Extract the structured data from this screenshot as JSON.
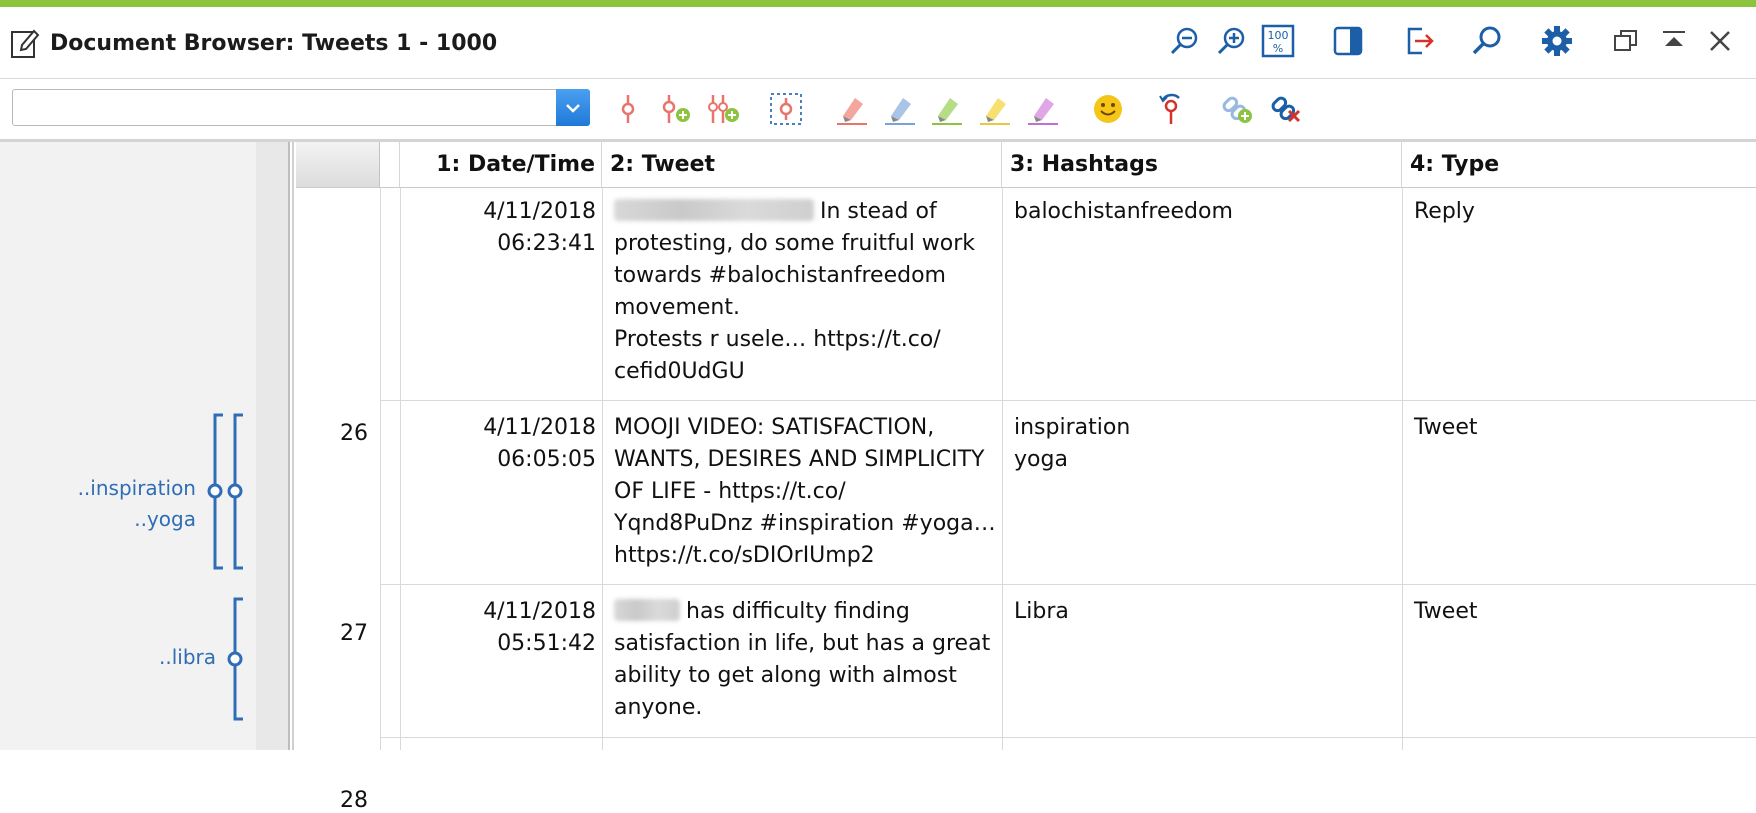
{
  "window": {
    "title": "Document Browser: Tweets 1 - 1000",
    "accent_color": "#8cc43f",
    "title_icons": [
      "zoom-out-icon",
      "zoom-in-icon",
      "zoom-100-icon",
      "panel-toggle-icon",
      "export-icon",
      "search-icon",
      "gear-icon",
      "restore-window-icon",
      "minimize-icon",
      "close-icon"
    ]
  },
  "toolbar": {
    "combo_value": "",
    "icons": [
      "code-icon",
      "code-add-icon",
      "code-multi-icon",
      "code-select-icon",
      "highlight-red-icon",
      "highlight-blue-icon",
      "highlight-green-icon",
      "highlight-yellow-icon",
      "highlight-purple-icon",
      "emoji-icon",
      "undo-code-icon",
      "link-add-icon",
      "link-remove-icon"
    ]
  },
  "codes": [
    {
      "labels": [
        "..inspiration",
        "..yoga"
      ],
      "color": "#2f6db5"
    },
    {
      "labels": [
        "..libra"
      ],
      "color": "#2f6db5"
    }
  ],
  "table": {
    "columns": [
      "1: Date/Time",
      "2: Tweet",
      "3: Hashtags",
      "4: Type"
    ],
    "rows": [
      {
        "num": "26",
        "date": "4/11/2018",
        "time": "06:23:41",
        "tweet_lines": [
          "In stead of",
          "protesting, do some fruitful work",
          "towards #balochistanfreedom",
          "movement.",
          "Protests r usele… https://t.co/",
          "cefid0UdGU"
        ],
        "hashtags": [
          "balochistanfreedom"
        ],
        "type": "Reply"
      },
      {
        "num": "27",
        "date": "4/11/2018",
        "time": "06:05:05",
        "tweet_lines": [
          "MOOJI VIDEO: SATISFACTION,",
          "WANTS, DESIRES AND SIMPLICITY",
          "OF LIFE -   https://t.co/",
          "Yqnd8PuDnz #inspiration  #yoga…",
          "https://t.co/sDIOrIUmp2"
        ],
        "hashtags": [
          "inspiration",
          "yoga"
        ],
        "type": "Tweet"
      },
      {
        "num": "28",
        "date": "4/11/2018",
        "time": "05:51:42",
        "tweet_lines": [
          "has difficulty finding",
          "satisfaction in life, but has a great",
          "ability to get along with almost",
          "anyone."
        ],
        "hashtags": [
          "Libra"
        ],
        "type": "Tweet"
      }
    ]
  }
}
